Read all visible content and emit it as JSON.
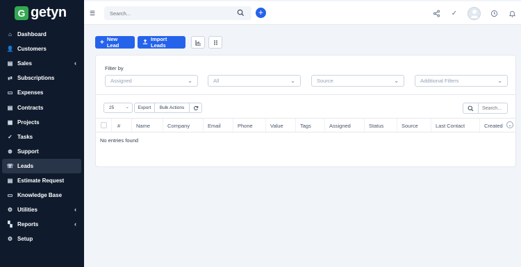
{
  "brand": {
    "name": "getyn",
    "mark": "G"
  },
  "sidebar": {
    "items": [
      {
        "label": "Dashboard",
        "icon": "home-icon",
        "glyph": "⌂"
      },
      {
        "label": "Customers",
        "icon": "user-icon",
        "glyph": "👤"
      },
      {
        "label": "Sales",
        "icon": "receipt-icon",
        "glyph": "▤",
        "chevron": "‹"
      },
      {
        "label": "Subscriptions",
        "icon": "repeat-icon",
        "glyph": "⇄"
      },
      {
        "label": "Expenses",
        "icon": "file-icon",
        "glyph": "▭"
      },
      {
        "label": "Contracts",
        "icon": "document-icon",
        "glyph": "▤"
      },
      {
        "label": "Projects",
        "icon": "chart-icon",
        "glyph": "▦"
      },
      {
        "label": "Tasks",
        "icon": "check-circle-icon",
        "glyph": "✓"
      },
      {
        "label": "Support",
        "icon": "lifebuoy-icon",
        "glyph": "⊛"
      },
      {
        "label": "Leads",
        "icon": "tty-icon",
        "glyph": "☏"
      },
      {
        "label": "Estimate Request",
        "icon": "file-text-icon",
        "glyph": "▤"
      },
      {
        "label": "Knowledge Base",
        "icon": "folder-icon",
        "glyph": "▭"
      },
      {
        "label": "Utilities",
        "icon": "cogs-icon",
        "glyph": "⚙",
        "chevron": "‹"
      },
      {
        "label": "Reports",
        "icon": "area-chart-icon",
        "glyph": "▚",
        "chevron": "‹"
      },
      {
        "label": "Setup",
        "icon": "gear-icon",
        "glyph": "⚙"
      }
    ],
    "active_index": 9
  },
  "topbar": {
    "search_placeholder": "Search...",
    "plus": "+"
  },
  "toolbar": {
    "new_lead": "New Lead",
    "import_leads": "Import Leads"
  },
  "filters": {
    "label": "Filter by",
    "selects": [
      "Assigned",
      "All",
      "Source",
      "Additional Filters"
    ]
  },
  "table_controls": {
    "page_size": "25",
    "export": "Export",
    "bulk_actions": "Bulk Actions",
    "search_placeholder": "Search..."
  },
  "table": {
    "columns": [
      "#",
      "Name",
      "Company",
      "Email",
      "Phone",
      "Value",
      "Tags",
      "Assigned",
      "Status",
      "Source",
      "Last Contact",
      "Created"
    ],
    "empty_message": "No entries found"
  },
  "colors": {
    "sidebar_bg": "#0f1b2d",
    "primary": "#2563eb",
    "logo": "#34a853"
  }
}
